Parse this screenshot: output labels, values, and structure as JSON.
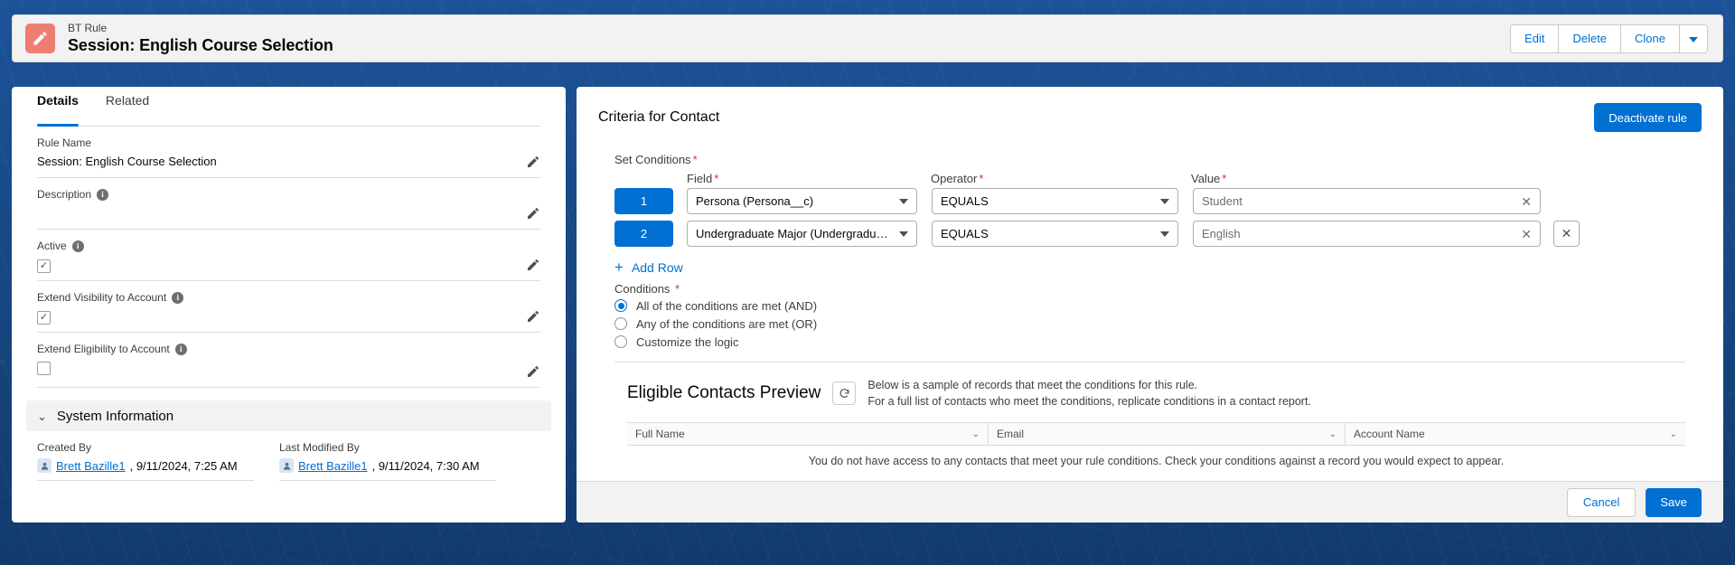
{
  "header": {
    "icon": "pencil-record-icon",
    "eyebrow": "BT Rule",
    "title": "Session: English Course Selection",
    "actions": [
      {
        "label": "Edit",
        "name": "edit-button"
      },
      {
        "label": "Delete",
        "name": "delete-button"
      },
      {
        "label": "Clone",
        "name": "clone-button"
      }
    ],
    "more_icon": "chevron-down-icon"
  },
  "left": {
    "tabs": [
      {
        "label": "Details",
        "active": true
      },
      {
        "label": "Related",
        "active": false
      }
    ],
    "fields": [
      {
        "label": "Rule Name",
        "value": "Session: English Course Selection",
        "info": false,
        "type": "text"
      },
      {
        "label": "Description",
        "value": "",
        "info": true,
        "type": "text"
      },
      {
        "label": "Active",
        "value": "",
        "info": true,
        "type": "checkbox",
        "checked": true
      },
      {
        "label": "Extend Visibility to Account",
        "value": "",
        "info": true,
        "type": "checkbox",
        "checked": true
      },
      {
        "label": "Extend Eligibility to Account",
        "value": "",
        "info": true,
        "type": "checkbox",
        "checked": false
      }
    ],
    "section": {
      "title": "System Information",
      "expanded": true
    },
    "system": [
      {
        "label": "Created By",
        "user": "Brett Bazille1",
        "meta": ", 9/11/2024, 7:25 AM"
      },
      {
        "label": "Last Modified By",
        "user": "Brett Bazille1",
        "meta": ", 9/11/2024, 7:30 AM"
      }
    ]
  },
  "right": {
    "title": "Criteria for Contact",
    "deactivate_label": "Deactivate rule",
    "set_conditions_label": "Set Conditions",
    "columns": {
      "field": "Field",
      "operator": "Operator",
      "value": "Value"
    },
    "rows": [
      {
        "num": "1",
        "field": "Persona (Persona__c)",
        "operator": "EQUALS",
        "value": "Student",
        "removable": false
      },
      {
        "num": "2",
        "field": "Undergraduate Major (Undergraduate...",
        "operator": "EQUALS",
        "value": "English",
        "removable": true
      }
    ],
    "add_row_label": "Add Row",
    "conditions_label": "Conditions",
    "condition_options": [
      {
        "label": "All of the conditions are met (AND)",
        "selected": true
      },
      {
        "label": "Any of the conditions are met (OR)",
        "selected": false
      },
      {
        "label": "Customize the logic",
        "selected": false
      }
    ],
    "preview": {
      "title": "Eligible Contacts Preview",
      "refresh_icon": "refresh-icon",
      "line1": "Below is a sample of records that meet the conditions for this rule.",
      "line2": "For a full list of contacts who meet the conditions, replicate conditions in a contact report.",
      "columns": [
        "Full Name",
        "Email",
        "Account Name"
      ],
      "empty_message": "You do not have access to any contacts that meet your rule conditions. Check your conditions against a record you would expect to appear."
    },
    "footer": {
      "cancel_label": "Cancel",
      "save_label": "Save"
    }
  },
  "colors": {
    "brand_blue": "#0070d2",
    "icon_salmon": "#ef7e72",
    "required_red": "#c23934",
    "background_blue": "#1b5297"
  }
}
